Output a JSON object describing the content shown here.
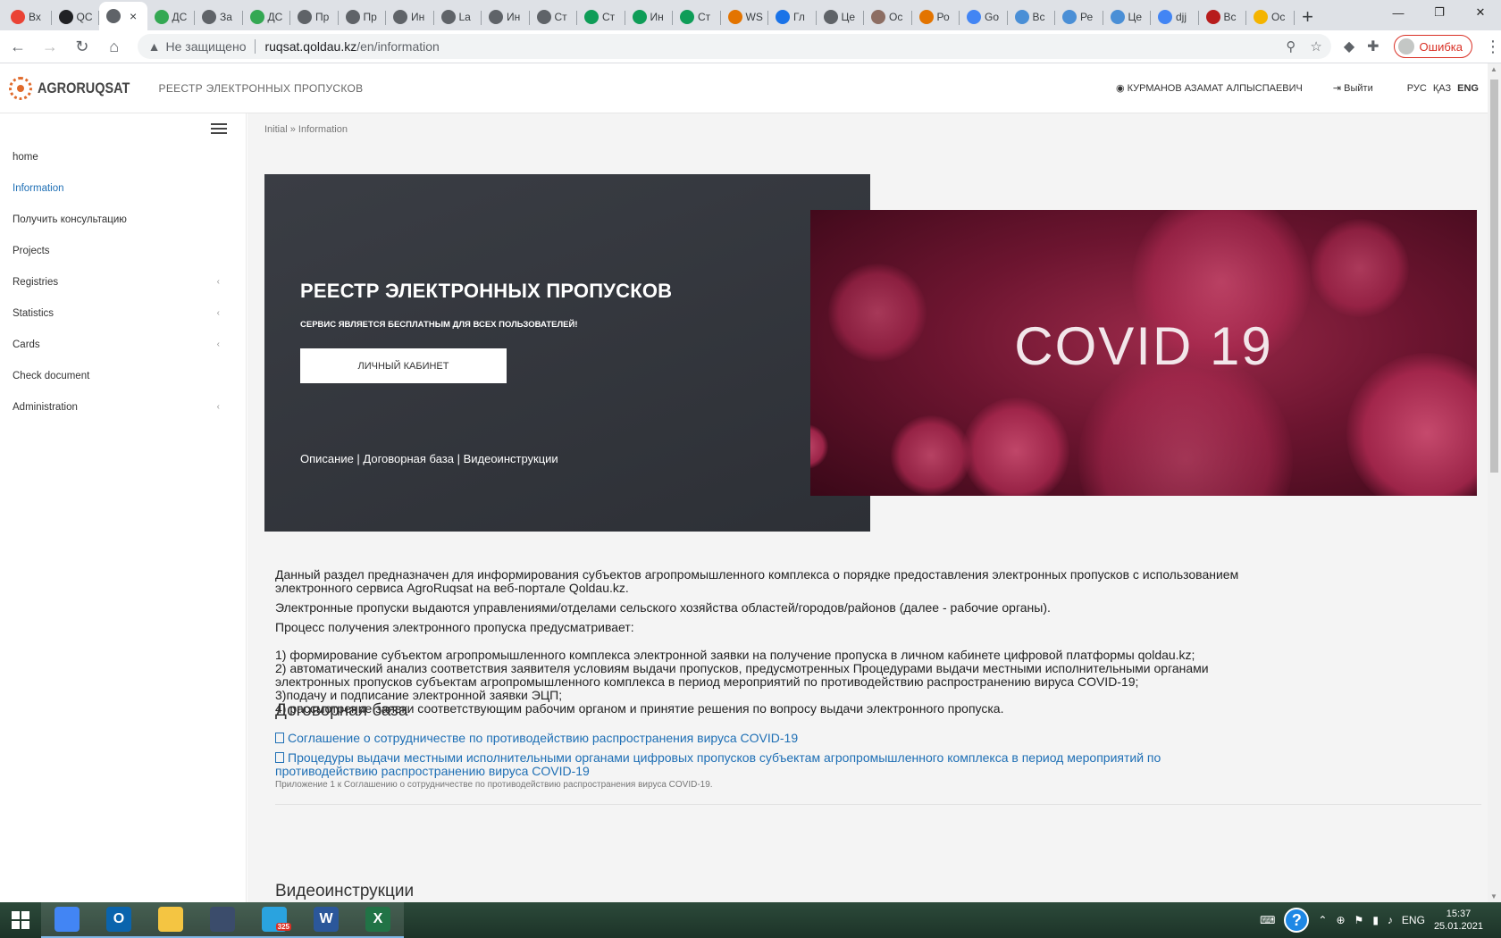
{
  "browser": {
    "tabs": [
      {
        "label": "Вх",
        "color": "#ea4335",
        "icon": "gmail-icon"
      },
      {
        "label": "QC",
        "color": "#202124",
        "icon": "at-icon"
      },
      {
        "label": "",
        "color": "#5f6368",
        "icon": "globe-icon",
        "active": true
      },
      {
        "label": "ДС",
        "color": "#34a853",
        "icon": "green-leaf-icon"
      },
      {
        "label": "За",
        "color": "#5f6368",
        "icon": "globe-icon"
      },
      {
        "label": "ДС",
        "color": "#34a853",
        "icon": "green-leaf-icon"
      },
      {
        "label": "Пр",
        "color": "#5f6368",
        "icon": "globe-icon"
      },
      {
        "label": "Пр",
        "color": "#5f6368",
        "icon": "globe-icon"
      },
      {
        "label": "Ин",
        "color": "#5f6368",
        "icon": "globe-icon"
      },
      {
        "label": "La",
        "color": "#5f6368",
        "icon": "globe-icon"
      },
      {
        "label": "Ин",
        "color": "#5f6368",
        "icon": "globe-icon"
      },
      {
        "label": "Ст",
        "color": "#5f6368",
        "icon": "globe-icon"
      },
      {
        "label": "Ст",
        "color": "#0f9d58",
        "icon": "sheets-icon"
      },
      {
        "label": "Ин",
        "color": "#0f9d58",
        "icon": "sheets-icon"
      },
      {
        "label": "Ст",
        "color": "#0f9d58",
        "icon": "sheets-icon"
      },
      {
        "label": "WS",
        "color": "#e37400",
        "icon": "ws-icon"
      },
      {
        "label": "Гл",
        "color": "#1a73e8",
        "icon": "wave-icon"
      },
      {
        "label": "Це",
        "color": "#5f6368",
        "icon": "globe-icon"
      },
      {
        "label": "Ос",
        "color": "#8d6e63",
        "icon": "gear-logo-icon"
      },
      {
        "label": "Ро",
        "color": "#e37400",
        "icon": "ws-icon"
      },
      {
        "label": "Go",
        "color": "#4285f4",
        "icon": "translate-icon"
      },
      {
        "label": "Вс",
        "color": "#4a8fd6",
        "icon": "who-icon"
      },
      {
        "label": "Ре",
        "color": "#4a8fd6",
        "icon": "who-icon"
      },
      {
        "label": "Це",
        "color": "#4a8fd6",
        "icon": "who-icon"
      },
      {
        "label": "djj",
        "color": "#4285f4",
        "icon": "google-icon"
      },
      {
        "label": "Вс",
        "color": "#b71c1c",
        "icon": "k-icon"
      },
      {
        "label": "Ос",
        "color": "#f4b400",
        "icon": "folder-chart-icon"
      }
    ],
    "active_tab_close": "×",
    "new_tab": "+",
    "window_controls": [
      "—",
      "❐",
      "✕"
    ],
    "security_label": "Не защищено",
    "url_host": "ruqsat.qoldau.kz",
    "url_path": "/en/information",
    "profile_label": "Ошибка"
  },
  "site": {
    "logo_text": "AGRORUQSAT",
    "registry_title": "РЕЕСТР ЭЛЕКТРОННЫХ ПРОПУСКОВ",
    "user_name": "КУРМАНОВ АЗАМАТ АЛПЫСПАЕВИЧ",
    "logout_label": "Выйти",
    "languages": [
      "РУС",
      "ҚАЗ",
      "ENG"
    ],
    "current_language": "ENG"
  },
  "sidebar": {
    "items": [
      {
        "label": "home",
        "active": false,
        "submenu": false
      },
      {
        "label": "Information",
        "active": true,
        "submenu": false
      },
      {
        "label": "Получить консультацию",
        "active": false,
        "submenu": false
      },
      {
        "label": "Projects",
        "active": false,
        "submenu": false
      },
      {
        "label": "Registries",
        "active": false,
        "submenu": true
      },
      {
        "label": "Statistics",
        "active": false,
        "submenu": true
      },
      {
        "label": "Cards",
        "active": false,
        "submenu": true
      },
      {
        "label": "Check document",
        "active": false,
        "submenu": false
      },
      {
        "label": "Administration",
        "active": false,
        "submenu": true
      }
    ]
  },
  "main": {
    "breadcrumb": "Initial » Information",
    "hero": {
      "title": "РЕЕСТР ЭЛЕКТРОННЫХ ПРОПУСКОВ",
      "subtitle": "СЕРВИС ЯВЛЯЕТСЯ БЕСПЛАТНЫМ ДЛЯ ВСЕХ ПОЛЬЗОВАТЕЛЕЙ!",
      "button": "ЛИЧНЫЙ КАБИНЕТ",
      "links": "Описание | Договорная база | Видеоинструкции",
      "image_text": "COVID 19"
    },
    "intro": [
      "Данный раздел предназначен для информирования субъектов агропромышленного комплекса о порядке предоставления электронных пропусков с использованием электронного сервиса AgroRuqsat на веб-портале Qoldau.kz.",
      "Электронные пропуски выдаются управлениями/отделами сельского хозяйства областей/городов/районов (далее - рабочие органы).",
      "Процесс получения электронного пропуска предусматривает:"
    ],
    "steps": [
      "1) формирование субъектом агропромышленного комплекса электронной заявки на получение пропуска в личном кабинете цифровой платформы qoldau.kz;",
      "2) автоматический анализ соответствия заявителя условиям выдачи пропусков, предусмотренных Процедурами выдачи местными исполнительными органами электронных пропусков субъектам агропромышленного комплекса в период мероприятий по противодействию распространению вируса COVID-19;",
      "3)подачу и подписание электронной заявки ЭЦП;",
      "4) рассмотрение заявки соответствующим рабочим органом и принятие решения по вопросу выдачи электронного пропуска."
    ],
    "contract_heading": "Договорная база",
    "documents": [
      {
        "title": "Соглашение о сотрудничестве по противодействию распространения вируса COVID-19",
        "note": ""
      },
      {
        "title": "Процедуры выдачи местными исполнительными органами цифровых пропусков субъектам агропромышленного комплекса в период мероприятий по противодействию распространению вируса COVID-19",
        "note": "Приложение 1 к Соглашению о сотрудничестве по противодействию распространения вируса COVID-19."
      }
    ],
    "video_heading": "Видеоинструкции"
  },
  "taskbar": {
    "apps": [
      {
        "name": "chrome",
        "label": "",
        "color": "#4285f4",
        "open": true
      },
      {
        "name": "outlook",
        "label": "O",
        "color": "#0a64ad",
        "open": true
      },
      {
        "name": "explorer",
        "label": "",
        "color": "#f4c542",
        "open": true
      },
      {
        "name": "vpn",
        "label": "",
        "color": "#3b4c6b",
        "open": true
      },
      {
        "name": "telegram",
        "label": "",
        "color": "#2aa3df",
        "open": true,
        "badge": "325"
      },
      {
        "name": "word",
        "label": "W",
        "color": "#2b579a",
        "open": true
      },
      {
        "name": "excel",
        "label": "X",
        "color": "#217346",
        "open": true
      }
    ],
    "help": "?",
    "lang": "ENG",
    "time": "15:37",
    "date": "25.01.2021"
  }
}
